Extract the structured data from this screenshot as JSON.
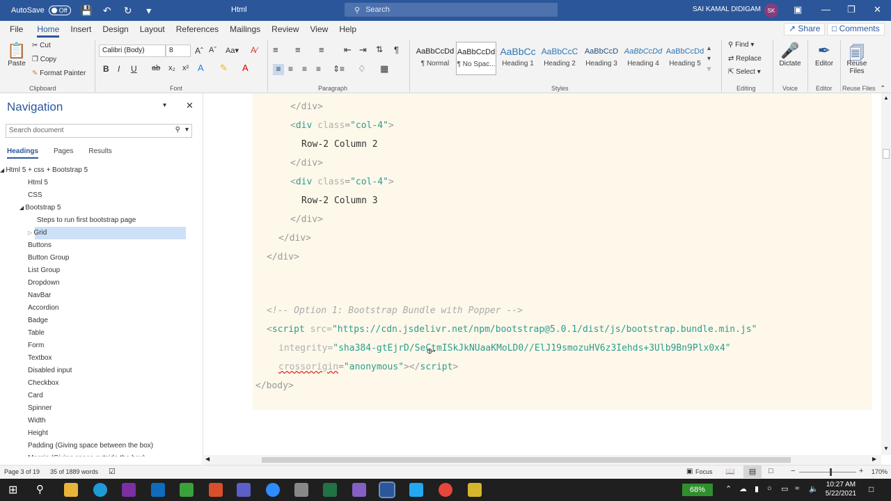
{
  "titlebar": {
    "autosave_label": "AutoSave",
    "autosave_state": "Off",
    "doc_title": "Html",
    "search_placeholder": "Search",
    "user_name": "SAI KAMAL DIDIGAM",
    "user_initials": "SK"
  },
  "menu": [
    "File",
    "Home",
    "Insert",
    "Design",
    "Layout",
    "References",
    "Mailings",
    "Review",
    "View",
    "Help"
  ],
  "menu_active": "Home",
  "share_label": "Share",
  "comments_label": "Comments",
  "ribbon": {
    "clipboard": {
      "paste": "Paste",
      "cut": "Cut",
      "copy": "Copy",
      "format_painter": "Format Painter",
      "label": "Clipboard"
    },
    "font": {
      "name": "Calibri (Body)",
      "size": "8",
      "label": "Font"
    },
    "paragraph_label": "Paragraph",
    "styles": [
      {
        "sample": "AaBbCcDd",
        "name": "¶ Normal"
      },
      {
        "sample": "AaBbCcDd",
        "name": "¶ No Spac..."
      },
      {
        "sample": "AaBbCc",
        "name": "Heading 1"
      },
      {
        "sample": "AaBbCcC",
        "name": "Heading 2"
      },
      {
        "sample": "AaBbCcD",
        "name": "Heading 3"
      },
      {
        "sample": "AaBbCcDd",
        "name": "Heading 4"
      },
      {
        "sample": "AaBbCcDd",
        "name": "Heading 5"
      }
    ],
    "styles_label": "Styles",
    "editing": {
      "find": "Find",
      "replace": "Replace",
      "select": "Select",
      "label": "Editing"
    },
    "voice": {
      "dictate": "Dictate",
      "label": "Voice"
    },
    "editor": {
      "editor": "Editor",
      "label": "Editor"
    },
    "reuse": {
      "line1": "Reuse",
      "line2": "Files",
      "label": "Reuse Files"
    }
  },
  "navigation": {
    "title": "Navigation",
    "search_placeholder": "Search document",
    "tabs": [
      "Headings",
      "Pages",
      "Results"
    ],
    "items": [
      {
        "text": "Html 5 + css + Bootstrap 5",
        "level": 0
      },
      {
        "text": "Html 5",
        "level": 1
      },
      {
        "text": "CSS",
        "level": 1
      },
      {
        "text": "Bootstrap 5",
        "level": 1
      },
      {
        "text": "Steps to run first bootstrap page",
        "level": 2
      },
      {
        "text": "Grid",
        "level": 2
      },
      {
        "text": "Buttons",
        "level": 1
      },
      {
        "text": "Button Group",
        "level": 1
      },
      {
        "text": "List Group",
        "level": 1
      },
      {
        "text": "Dropdown",
        "level": 1
      },
      {
        "text": "NavBar",
        "level": 1
      },
      {
        "text": "Accordion",
        "level": 1
      },
      {
        "text": "Badge",
        "level": 1
      },
      {
        "text": "Table",
        "level": 1
      },
      {
        "text": "Form",
        "level": 1
      },
      {
        "text": "Textbox",
        "level": 1
      },
      {
        "text": "Disabled input",
        "level": 1
      },
      {
        "text": "Checkbox",
        "level": 1
      },
      {
        "text": "Card",
        "level": 1
      },
      {
        "text": "Spinner",
        "level": 1
      },
      {
        "text": "Width",
        "level": 1
      },
      {
        "text": "Height",
        "level": 1
      },
      {
        "text": "Padding (Giving space between the box)",
        "level": 1
      },
      {
        "text": "Margin (Giving space outside the box)",
        "level": 1
      }
    ]
  },
  "code": {
    "close_div": "</div>",
    "open_col": "<div class=\"col-4\">",
    "r2c2": "Row-2 Column 2",
    "r2c3": "Row-2 Column 3",
    "comment": "<!-- Option 1: Bootstrap Bundle with Popper -->",
    "script_open": "<script",
    "src_attr": " src=",
    "src_val": "\"https://cdn.jsdelivr.net/npm/bootstrap@5.0.1/dist/js/bootstrap.bundle.min.js\"",
    "integrity_attr": "integrity=",
    "integrity_val": "\"sha384-gtEjrD/SeCtmISkJkNUaaKMoLD0//ElJ19smozuHV6z3Iehds+3Ulb9Bn9Plx0x4\"",
    "crossorigin_attr": "crossorigin",
    "crossorigin_eq": "=",
    "crossorigin_val": "\"anonymous\"",
    "script_close": "></",
    "script_word": "script",
    "gt": ">",
    "body_close": "</body>"
  },
  "status": {
    "page": "Page 3 of 19",
    "words": "35 of 1889 words",
    "focus": "Focus",
    "zoom": "170%"
  },
  "taskbar": {
    "battery": "68%",
    "time": "10:27 AM",
    "date": "5/22/2021"
  }
}
